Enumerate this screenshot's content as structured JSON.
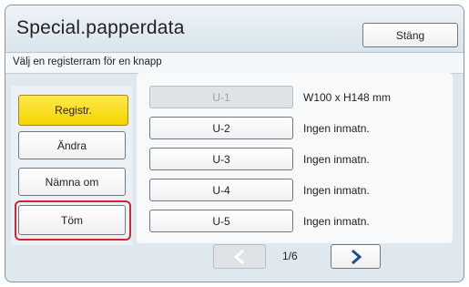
{
  "header": {
    "title": "Special.papperdata",
    "close_label": "Stäng"
  },
  "instruction": "Välj en registerram för en knapp",
  "side_buttons": {
    "registr": "Registr.",
    "andra": "Ändra",
    "namna_om": "Nämna om",
    "tom": "Töm"
  },
  "slots": [
    {
      "label": "U-1",
      "value": "W100 x H148 mm",
      "selected": true
    },
    {
      "label": "U-2",
      "value": "Ingen inmatn."
    },
    {
      "label": "U-3",
      "value": "Ingen inmatn."
    },
    {
      "label": "U-4",
      "value": "Ingen inmatn."
    },
    {
      "label": "U-5",
      "value": "Ingen inmatn."
    }
  ],
  "pager": {
    "indicator": "1/6",
    "prev_icon": "chevron-left-icon",
    "next_icon": "chevron-right-icon"
  },
  "colors": {
    "accent_yellow": "#f5d400",
    "highlight_red": "#d6242e",
    "pager_arrow": "#1e4e8c"
  }
}
